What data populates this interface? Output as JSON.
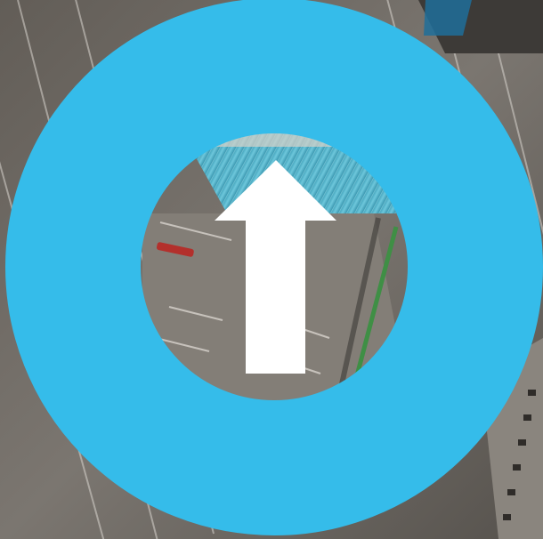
{
  "map": {
    "view": "satellite",
    "heading_indicator": {
      "icon": "north-arrow-icon",
      "direction": "up"
    }
  },
  "colors": {
    "ring": "#35bcea",
    "arrow": "#ffffff",
    "pavement": "#7b7670",
    "pavement_dark": "#5d5954",
    "roof": "#4fb2c9",
    "roof_light": "#7fd0e0",
    "green_strip": "#3f8f45",
    "red_vehicle": "#b3302c",
    "building_dark": "#3d3a37"
  }
}
